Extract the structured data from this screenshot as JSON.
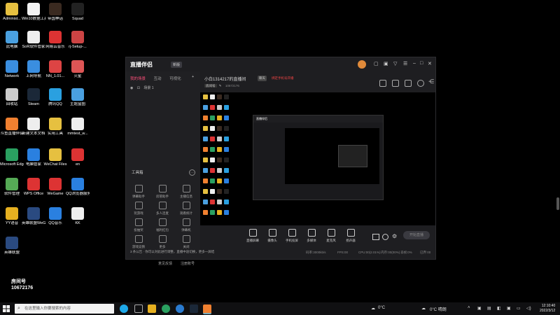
{
  "desktop": {
    "icons": [
      {
        "label": "Administ...",
        "color": "#e6c040"
      },
      {
        "label": "Win10数据工具",
        "color": "#f2f2f2"
      },
      {
        "label": "帝国神话",
        "color": "#3a2a20"
      },
      {
        "label": "Squad",
        "color": "#222"
      },
      {
        "label": "此电脑",
        "color": "#4aa0e0"
      },
      {
        "label": "SoR软件管家",
        "color": "#eee"
      },
      {
        "label": "网易云音乐",
        "color": "#d33"
      },
      {
        "label": "rj-Setup-...",
        "color": "#c44"
      },
      {
        "label": "Network",
        "color": "#3a8ee0"
      },
      {
        "label": "上网导航",
        "color": "#3a8ee0"
      },
      {
        "label": "NN_1.01...",
        "color": "#d44"
      },
      {
        "label": "火星",
        "color": "#d55"
      },
      {
        "label": "回收站",
        "color": "#ccc"
      },
      {
        "label": "Steam",
        "color": "#1b2838"
      },
      {
        "label": "腾讯QQ",
        "color": "#2aa0e0"
      },
      {
        "label": "主题盒图",
        "color": "#4aa0e0"
      },
      {
        "label": "斗鱼直播伴侣",
        "color": "#f08030"
      },
      {
        "label": "新建文本文档",
        "color": "#eee"
      },
      {
        "label": "实用工具",
        "color": "#e6c040"
      },
      {
        "label": "mmtest_w...",
        "color": "#eee"
      },
      {
        "label": "Microsoft Edge",
        "color": "#2aa060"
      },
      {
        "label": "电脑管家",
        "color": "#2a80e0"
      },
      {
        "label": "WeChat Files",
        "color": "#e6c040"
      },
      {
        "label": "en",
        "color": "#d33"
      },
      {
        "label": "软件管理",
        "color": "#5a5"
      },
      {
        "label": "WPS Office",
        "color": "#d33"
      },
      {
        "label": "WeGame",
        "color": "#d33"
      },
      {
        "label": "QQ浏览器服务",
        "color": "#2a80e0"
      },
      {
        "label": "YY语音",
        "color": "#e6b020"
      },
      {
        "label": "英雄联盟WeGame版",
        "color": "#2a4a80"
      },
      {
        "label": "QQ音乐",
        "color": "#2a80e0"
      },
      {
        "label": "KK",
        "color": "#eee"
      },
      {
        "label": "英雄联盟",
        "color": "#2a4a80"
      }
    ],
    "room_overlay": {
      "line1": "房间号",
      "line2": "10672176"
    }
  },
  "app": {
    "logo": "直播伴侣",
    "logo_tag": "新版",
    "tabs": [
      "我的场景",
      "互动",
      "可视化"
    ],
    "scene_item": "场景 1",
    "room_title": "小白1314217的直播间",
    "badge_category": "聊天",
    "badge_status": "绑定手机号开播",
    "room_id_label": "房间号",
    "room_id": "10672176",
    "toolbox_title": "工具箱",
    "tools": [
      {
        "label": "弹幕助手"
      },
      {
        "label": "房管助手"
      },
      {
        "label": "主播信息"
      },
      {
        "label": "玩游戏"
      },
      {
        "label": "多人连麦"
      },
      {
        "label": "观看统计"
      },
      {
        "label": "投抽奖"
      },
      {
        "label": "福利红包"
      },
      {
        "label": "弹幕机"
      },
      {
        "label": "游戏竞猜"
      },
      {
        "label": "更多"
      },
      {
        "label": "关闭"
      }
    ],
    "bottom_tools": [
      {
        "label": "直播屏幕"
      },
      {
        "label": "摄像头"
      },
      {
        "label": "手机投屏"
      },
      {
        "label": "多媒体"
      },
      {
        "label": "麦克风"
      },
      {
        "label": "扬声器"
      }
    ],
    "start_button": "开始直播",
    "stats": [
      "码率:3000kb/s",
      "FPS:00",
      "CPU:00(2.01%)",
      "内存:00(00%)",
      "丢帧:0%",
      "已弃:00"
    ],
    "announce": "3 条公告 · 你可以对此进行调整，直播中途切换，更多一屏结",
    "footer_links": [
      "意见反馈",
      "注册账号"
    ]
  },
  "taskbar": {
    "search_placeholder": "在这里输入你要搜索的内容",
    "weather": "0°C",
    "tray_weather": "0°C 晴朗",
    "time": "12:10:40",
    "date": "2022/3/12"
  }
}
